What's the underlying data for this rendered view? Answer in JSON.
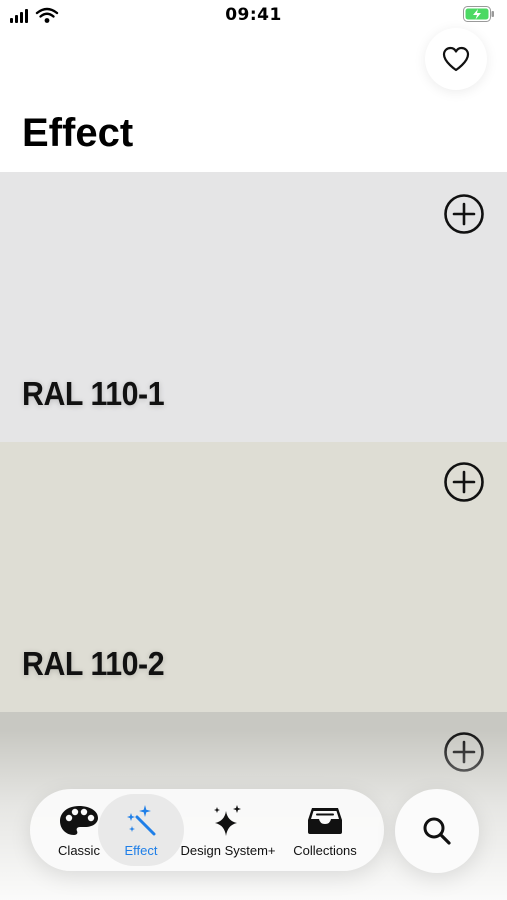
{
  "status_bar": {
    "time": "09:41",
    "signal_icon": "cellular-signal-icon",
    "wifi_icon": "wifi-icon",
    "battery_icon": "battery-charging-icon",
    "battery_color": "#4cd964"
  },
  "header": {
    "favorite_icon": "heart-icon",
    "title": "Effect"
  },
  "swatches": [
    {
      "name": "RAL 110-1",
      "color": "#e5e5e6",
      "add_icon": "plus-circle-icon"
    },
    {
      "name": "RAL 110-2",
      "color": "#deddd4",
      "add_icon": "plus-circle-icon"
    },
    {
      "name": "",
      "color": "#c8c8c2",
      "add_icon": "plus-circle-icon"
    }
  ],
  "tab_bar": {
    "active": "Effect",
    "accent_color": "#1f7fe8",
    "tabs": [
      {
        "label": "Classic",
        "icon": "palette-icon"
      },
      {
        "label": "Effect",
        "icon": "magic-wand-icon"
      },
      {
        "label": "Design System+",
        "icon": "sparkles-icon"
      },
      {
        "label": "Collections",
        "icon": "tray-icon"
      }
    ]
  },
  "search": {
    "icon": "search-icon"
  }
}
